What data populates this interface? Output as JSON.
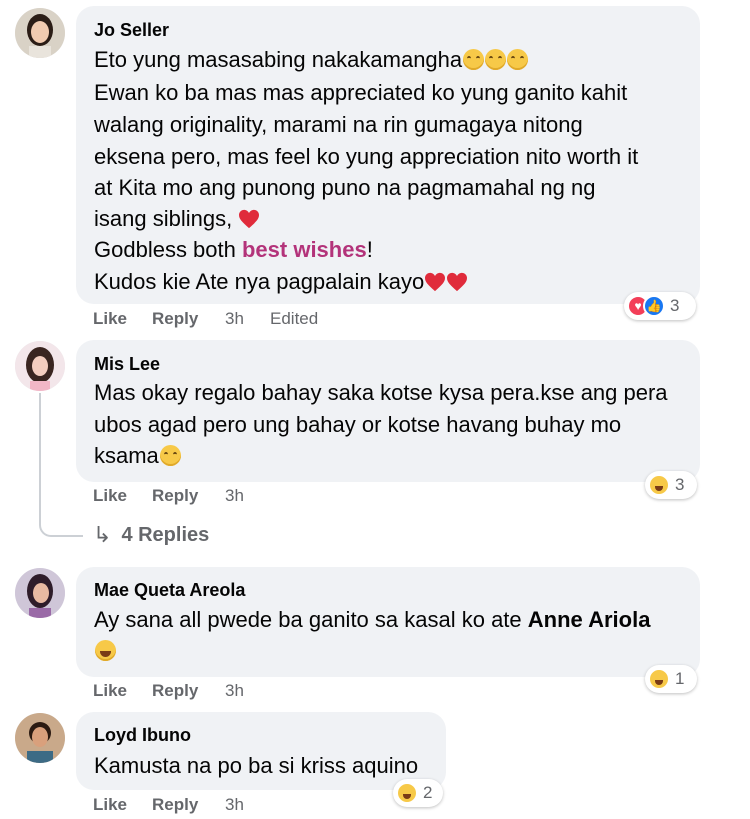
{
  "colors": {
    "bubble": "#f0f2f5",
    "meta_text": "#65676b",
    "highlight": "#b3337a",
    "love": "#f33e58",
    "like": "#1877f2",
    "haha": "#f7c948"
  },
  "comments": [
    {
      "author": "Jo Seller",
      "lines": [
        "Eto yung masasabing nakakamangha",
        "Ewan ko ba mas mas appreciated ko yung ganito kahit",
        "walang originality, marami na rin gumagaya nitong",
        "eksena pero, mas feel ko yung appreciation nito worth it",
        "at Kita mo ang punong puno na pagmamahal ng ng",
        "isang siblings,",
        "Godbless both ",
        "best wishes",
        "!",
        "Kudos kie Ate nya pagpalain kayo"
      ],
      "actions": {
        "like": "Like",
        "reply": "Reply",
        "time": "3h",
        "edited": "Edited"
      },
      "reactions": {
        "icons": [
          "love-icon",
          "like-icon"
        ],
        "count": "3"
      }
    },
    {
      "author": "Mis Lee",
      "lines": [
        "Mas okay regalo bahay saka kotse kysa pera.kse ang pera",
        "ubos agad pero ung bahay or kotse havang buhay mo",
        "ksama"
      ],
      "actions": {
        "like": "Like",
        "reply": "Reply",
        "time": "3h"
      },
      "reactions": {
        "icons": [
          "haha-icon"
        ],
        "count": "3"
      },
      "replies_label": "4 Replies"
    },
    {
      "author": "Mae Queta Areola",
      "lines": [
        "Ay sana all pwede ba ganito sa kasal ko ate ",
        "Anne Ariola"
      ],
      "actions": {
        "like": "Like",
        "reply": "Reply",
        "time": "3h"
      },
      "reactions": {
        "icons": [
          "haha-icon"
        ],
        "count": "1"
      }
    },
    {
      "author": "Loyd Ibuno",
      "lines": [
        "Kamusta na po ba si kriss aquino"
      ],
      "actions": {
        "like": "Like",
        "reply": "Reply",
        "time": "3h"
      },
      "reactions": {
        "icons": [
          "haha-icon"
        ],
        "count": "2"
      }
    }
  ]
}
